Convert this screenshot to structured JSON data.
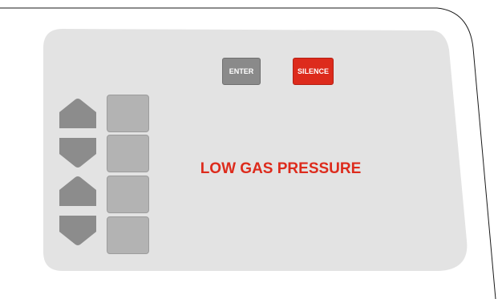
{
  "panel": {
    "alarm_message": "LOW GAS PRESSURE",
    "enter_label": "ENTER",
    "silence_label": "SILENCE"
  },
  "display_cells": [
    {
      "label": ""
    },
    {
      "label": ""
    },
    {
      "label": ""
    },
    {
      "label": ""
    }
  ],
  "icons": {
    "up_arrow_1": "arrow-up-icon",
    "down_arrow_1": "arrow-down-icon",
    "up_arrow_2": "arrow-up-icon",
    "down_arrow_2": "arrow-down-icon"
  },
  "colors": {
    "panel_fill": "#e3e3e3",
    "button_gray": "#8a8a8a",
    "alarm_red": "#dd2b1c",
    "cell_gray": "#b3b3b3",
    "arrow_gray": "#8c8c8c"
  }
}
